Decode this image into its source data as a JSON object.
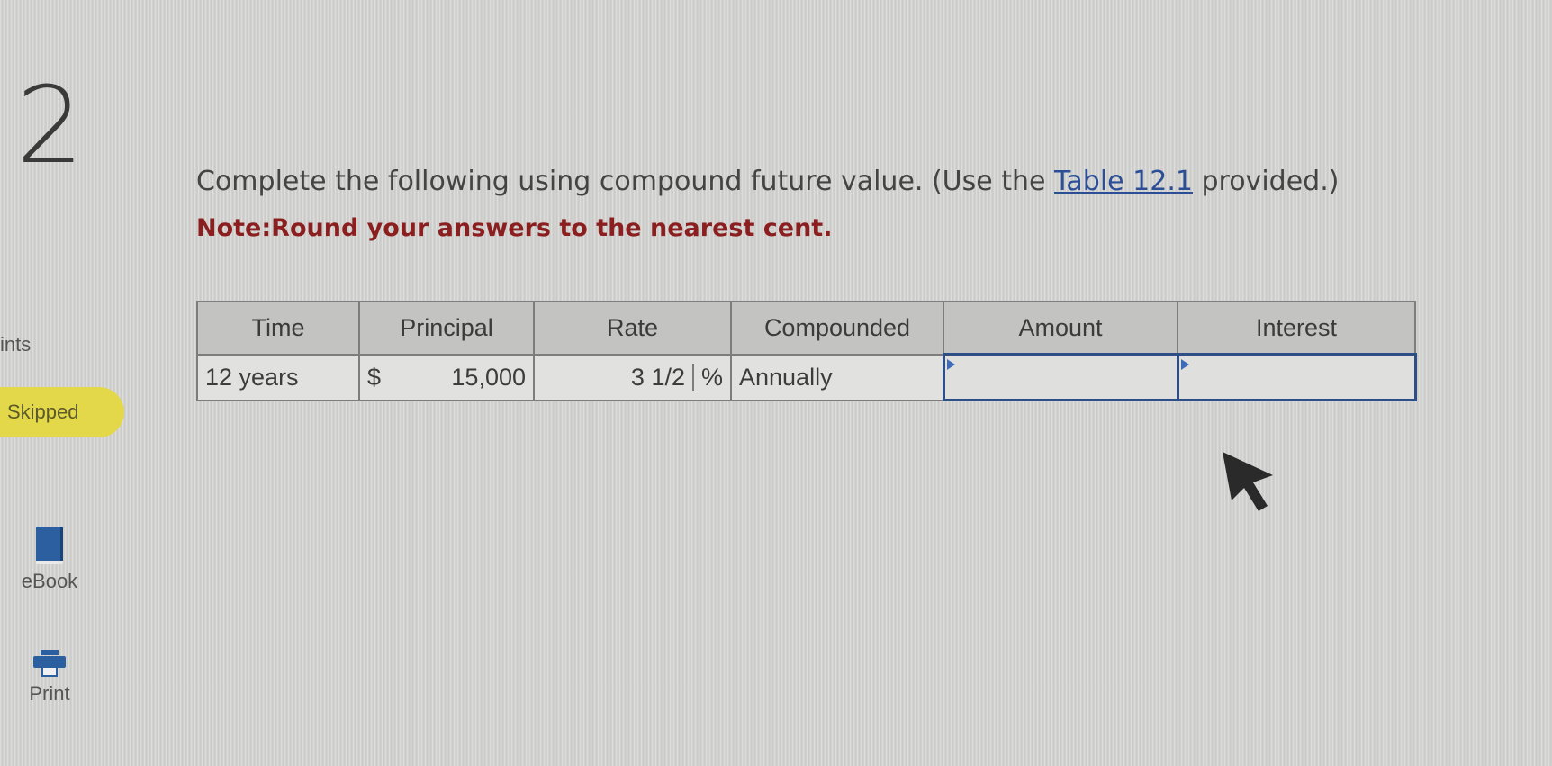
{
  "question": {
    "number": "2"
  },
  "sidebar": {
    "points_label": "ints",
    "status_badge": "Skipped",
    "ebook_label": "eBook",
    "print_label": "Print"
  },
  "prompt": {
    "text_before_link": "Complete the following using compound future value. (Use the ",
    "link_text": "Table 12.1",
    "text_after_link": " provided.)",
    "note": "Note:Round your answers to the nearest cent."
  },
  "table": {
    "headers": [
      "Time",
      "Principal",
      "Rate",
      "Compounded",
      "Amount",
      "Interest"
    ],
    "row": {
      "time": "12 years",
      "principal_currency": "$",
      "principal_value": "15,000",
      "rate_value": "3 1/2",
      "rate_unit": "%",
      "compounded": "Annually",
      "amount_value": "",
      "interest_value": ""
    }
  },
  "colors": {
    "link": "#2b4e96",
    "note": "#8b1f1f",
    "badge": "#e3d84a",
    "input_border": "#2e4f85",
    "icon_blue": "#2c5fa0"
  }
}
